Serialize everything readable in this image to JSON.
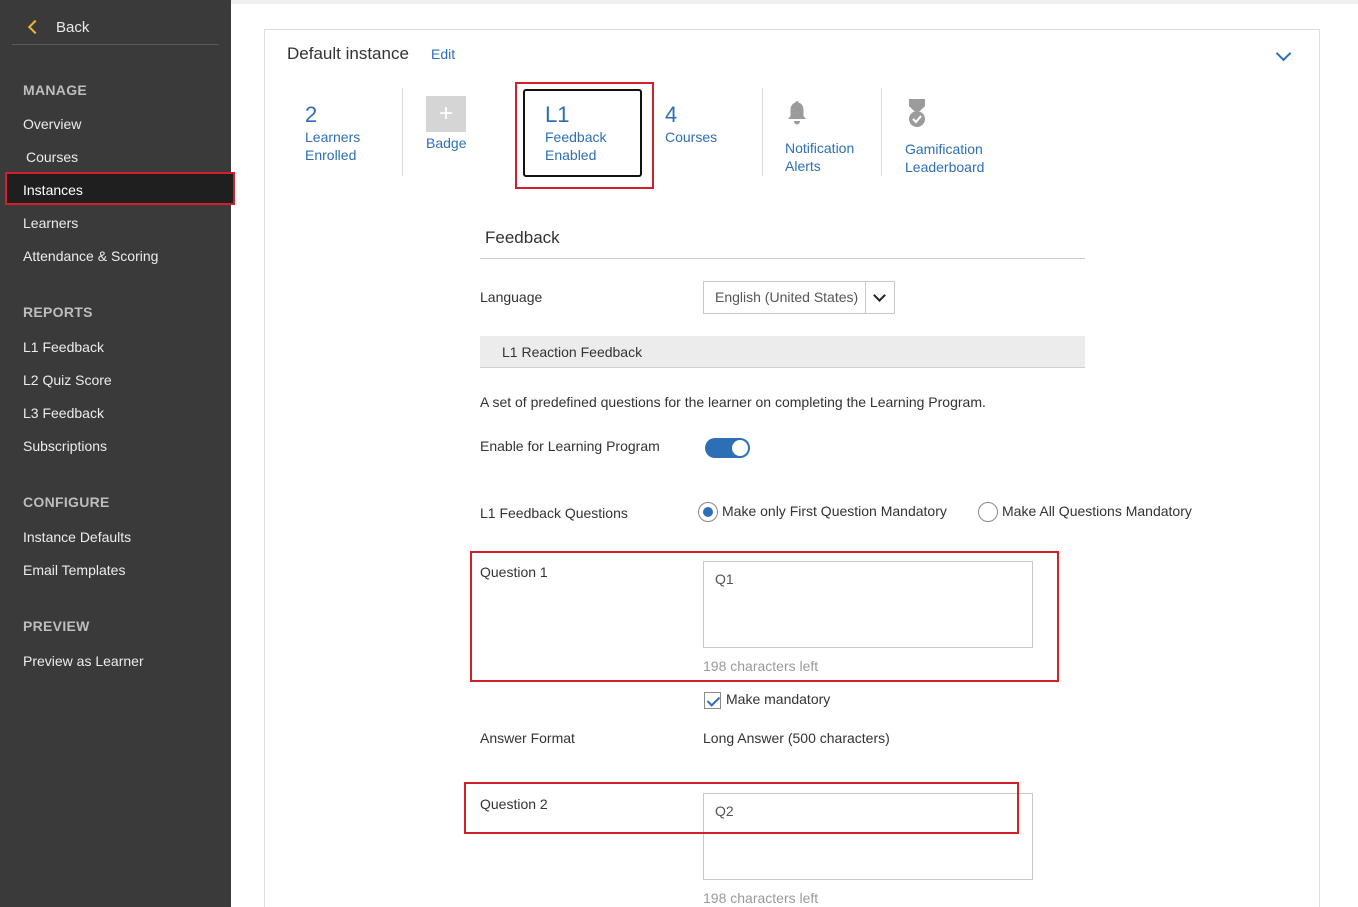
{
  "sidebar": {
    "back_label": "Back",
    "sections": {
      "manage": "MANAGE",
      "reports": "REPORTS",
      "configure": "CONFIGURE",
      "preview": "PREVIEW"
    },
    "items": {
      "overview": "Overview",
      "courses": "Courses",
      "instances": "Instances",
      "learners": "Learners",
      "attendance": "Attendance & Scoring",
      "l1_feedback": "L1 Feedback",
      "l2_quiz": "L2 Quiz Score",
      "l3_feedback": "L3 Feedback",
      "subscriptions": "Subscriptions",
      "instance_defaults": "Instance Defaults",
      "email_templates": "Email Templates",
      "preview_learner": "Preview as Learner"
    }
  },
  "instance": {
    "title": "Default instance",
    "edit_label": "Edit",
    "stats": {
      "learners": {
        "num": "2",
        "line1": "Learners",
        "line2": "Enrolled"
      },
      "badge": {
        "symbol": "+",
        "line1": "Badge"
      },
      "l1": {
        "num": "L1",
        "line1": "Feedback",
        "line2": "Enabled"
      },
      "courses": {
        "num": "4",
        "line1": "Courses"
      },
      "notification": {
        "line1": "Notification",
        "line2": "Alerts"
      },
      "gamification": {
        "line1": "Gamification",
        "line2": "Leaderboard"
      }
    }
  },
  "feedback": {
    "title": "Feedback",
    "language_label": "Language",
    "language_value": "English (United States)",
    "tab_label": "L1 Reaction Feedback",
    "description": "A set of predefined questions for the learner on completing the Learning Program.",
    "enable_label": "Enable for Learning Program",
    "questions_label": "L1 Feedback Questions",
    "radio_first": "Make only First Question Mandatory",
    "radio_all": "Make All Questions Mandatory",
    "q1": {
      "label": "Question 1",
      "value": "Q1",
      "chars_left": "198 characters left",
      "mandatory_label": "Make mandatory"
    },
    "answer_format_label": "Answer Format",
    "answer_format_value": "Long Answer (500 characters)",
    "q2": {
      "label": "Question 2",
      "value": "Q2",
      "chars_left": "198 characters left"
    }
  },
  "colors": {
    "sidebar_bg": "#3a3a3a",
    "accent_blue": "#2d6fb7",
    "highlight_red": "#d41f2a",
    "back_chevron": "#f0b43c"
  }
}
